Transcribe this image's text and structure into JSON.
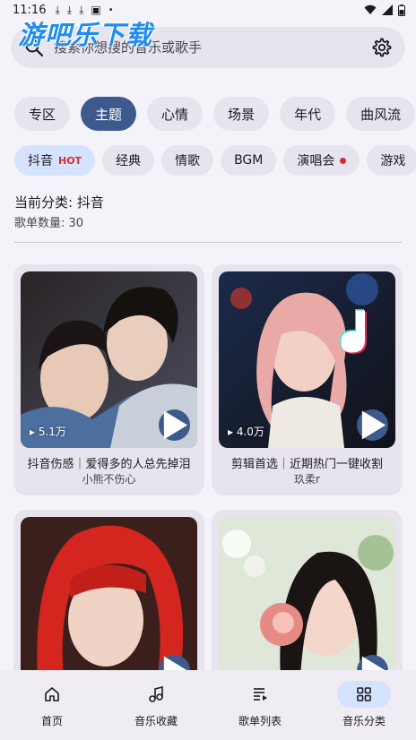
{
  "status_bar": {
    "time": "11:16",
    "download_icons": [
      "download-icon",
      "download-icon",
      "download-icon"
    ]
  },
  "watermark": "游吧乐下载",
  "search": {
    "placeholder": "搜索你想搜的音乐或歌手"
  },
  "primary_tabs": [
    {
      "label": "专区",
      "selected": false
    },
    {
      "label": "主题",
      "selected": true
    },
    {
      "label": "心情",
      "selected": false
    },
    {
      "label": "场景",
      "selected": false
    },
    {
      "label": "年代",
      "selected": false
    },
    {
      "label": "曲风流",
      "selected": false
    }
  ],
  "secondary_tabs": [
    {
      "label": "抖音",
      "badge": "HOT",
      "selected": true
    },
    {
      "label": "经典",
      "selected": false
    },
    {
      "label": "情歌",
      "selected": false
    },
    {
      "label": "BGM",
      "selected": false
    },
    {
      "label": "演唱会",
      "dot": true,
      "selected": false
    },
    {
      "label": "游戏",
      "selected": false
    }
  ],
  "category": {
    "title": "当前分类: 抖音",
    "count": "歌单数量: 30"
  },
  "playlists": [
    {
      "title": "抖音伤感｜爱得多的人总先掉泪",
      "author": "小熊不伤心",
      "plays": "5.1万"
    },
    {
      "title": "剪辑首选｜近期热门一键收割",
      "author": "玖柔r",
      "plays": "4.0万"
    },
    {
      "title": "",
      "author": "",
      "plays": ""
    },
    {
      "title": "",
      "author": "",
      "plays": ""
    }
  ],
  "bottom_nav": [
    {
      "label": "首页",
      "icon": "home-icon",
      "active": false
    },
    {
      "label": "音乐收藏",
      "icon": "music-note-icon",
      "active": false
    },
    {
      "label": "歌单列表",
      "icon": "playlist-icon",
      "active": false
    },
    {
      "label": "音乐分类",
      "icon": "grid-icon",
      "active": true
    }
  ],
  "colors": {
    "accent": "#3d5a8f",
    "accent_light": "#d6e3ff",
    "hot": "#d32f2f",
    "surface": "#e7e4ee",
    "background": "#f5f3fa"
  }
}
